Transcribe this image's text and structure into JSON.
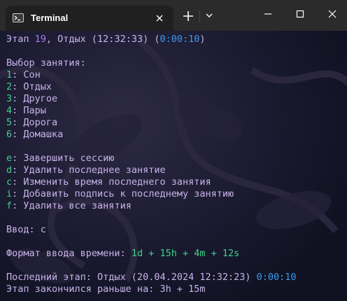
{
  "window": {
    "tab_title": "Terminal",
    "icons": {
      "tab": "terminal-icon",
      "close_tab": "close-icon",
      "new_tab": "plus-icon",
      "dropdown": "chevron-down-icon",
      "minimize": "minimize-icon",
      "maximize": "maximize-icon",
      "close": "close-icon"
    }
  },
  "terminal": {
    "status": {
      "prefix": "Этап ",
      "stage_number": "19",
      "middle": ", Отдых (12:32:33) (",
      "duration": "0:00:10",
      "suffix": ")"
    },
    "choose_header": "Выбор занятия:",
    "activities": [
      {
        "key": "1",
        "label": ": Сон"
      },
      {
        "key": "2",
        "label": ": Отдых"
      },
      {
        "key": "3",
        "label": ": Другое"
      },
      {
        "key": "4",
        "label": ": Пары"
      },
      {
        "key": "5",
        "label": ": Дорога"
      },
      {
        "key": "6",
        "label": ": Домашка"
      }
    ],
    "commands": [
      {
        "key": "e",
        "label": ": Завершить сессию"
      },
      {
        "key": "d",
        "label": ": Удалить последнее занятие"
      },
      {
        "key": "c",
        "label": ": Изменить время последнего занятия"
      },
      {
        "key": "i",
        "label": ": Добавить подпись к последнему занятию"
      },
      {
        "key": "f",
        "label": ": Удалить все занятия"
      }
    ],
    "input_prompt": "Ввод: с",
    "format_label": "Формат ввода времени: ",
    "format_value": "1d + 15h + 4m + 12s",
    "last_stage_label": "Последний этап: Отдых (20.04.2024 12:32:23) ",
    "last_stage_duration": "0:00:10",
    "ended_early": "Этап закончился раньше на: 3h + 15m"
  },
  "colors": {
    "titlebar": "#2b2b2b",
    "tab_bg": "#202020",
    "text": "#c9b3ea",
    "number": "#aa7df0",
    "time": "#3a9af0",
    "key": "#3ed28a"
  }
}
